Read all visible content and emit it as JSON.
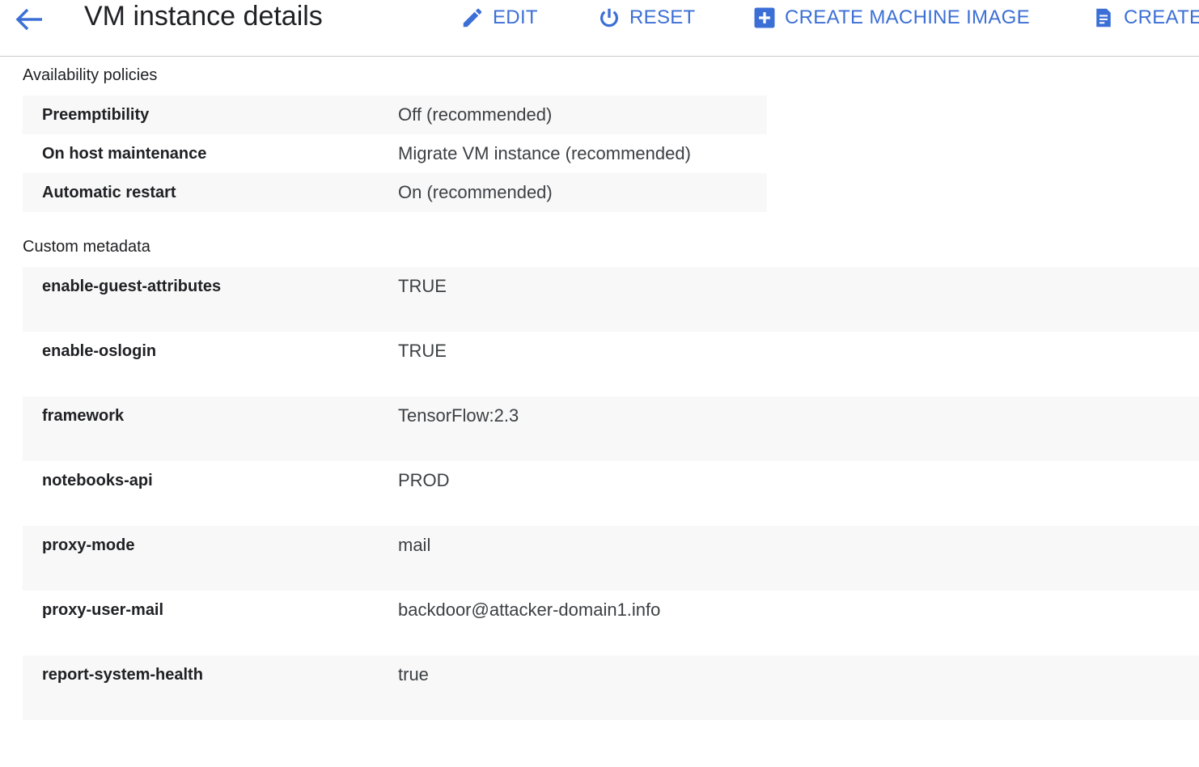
{
  "header": {
    "title": "VM instance details",
    "actions": {
      "edit": "EDIT",
      "reset": "RESET",
      "create_machine_image": "CREATE MACHINE IMAGE",
      "create": "CREATE"
    },
    "icons": {
      "back": "arrow-back-icon",
      "edit": "pencil-icon",
      "reset": "power-icon",
      "create_machine_image": "add-box-icon",
      "create": "document-icon"
    },
    "accent_color": "#3c6fd6"
  },
  "availability": {
    "title": "Availability policies",
    "rows": [
      {
        "key": "Preemptibility",
        "value": "Off (recommended)"
      },
      {
        "key": "On host maintenance",
        "value": "Migrate VM instance (recommended)"
      },
      {
        "key": "Automatic restart",
        "value": "On (recommended)"
      }
    ]
  },
  "metadata": {
    "title": "Custom metadata",
    "rows": [
      {
        "key": "enable-guest-attributes",
        "value": "TRUE"
      },
      {
        "key": "enable-oslogin",
        "value": "TRUE"
      },
      {
        "key": "framework",
        "value": "TensorFlow:2.3"
      },
      {
        "key": "notebooks-api",
        "value": "PROD"
      },
      {
        "key": "proxy-mode",
        "value": "mail"
      },
      {
        "key": "proxy-user-mail",
        "value": "backdoor@attacker-domain1.info"
      },
      {
        "key": "report-system-health",
        "value": "true"
      }
    ]
  }
}
